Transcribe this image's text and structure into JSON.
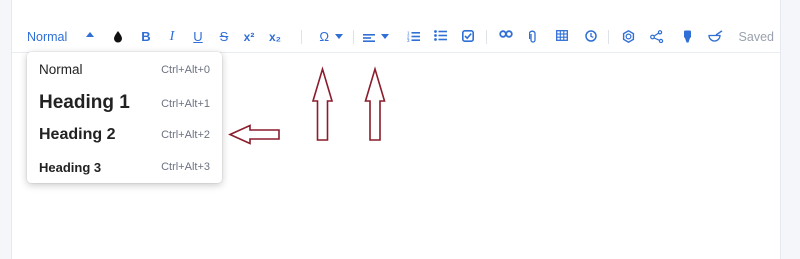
{
  "toolbar": {
    "style_select_value": "Normal",
    "status": "Saved",
    "buttons": [
      "chevron-up-icon",
      "text-color-icon",
      "bold-icon",
      "italic-icon",
      "underline-icon",
      "strikethrough-icon",
      "superscript-icon",
      "subscript-icon",
      "special-characters-icon",
      "align-icon",
      "numbered-list-icon",
      "bulleted-list-icon",
      "checklist-icon",
      "link-icon",
      "attachment-icon",
      "table-icon",
      "clock-icon",
      "shape-icon",
      "diagram-icon",
      "marker-icon",
      "paint-icon"
    ],
    "labels": {
      "bold": "B",
      "italic": "I",
      "underline": "U",
      "strike": "S",
      "superscript": "x²",
      "subscript": "x₂",
      "omega": "Ω"
    }
  },
  "style_menu": {
    "items": [
      {
        "label": "Normal",
        "shortcut": "Ctrl+Alt+0"
      },
      {
        "label": "Heading 1",
        "shortcut": "Ctrl+Alt+1"
      },
      {
        "label": "Heading 2",
        "shortcut": "Ctrl+Alt+2"
      },
      {
        "label": "Heading 3",
        "shortcut": "Ctrl+Alt+3"
      }
    ]
  },
  "colors": {
    "accent": "#2f6fd6",
    "annotation_arrow": "#8a1c2c",
    "status_text": "#9aa2ad"
  }
}
